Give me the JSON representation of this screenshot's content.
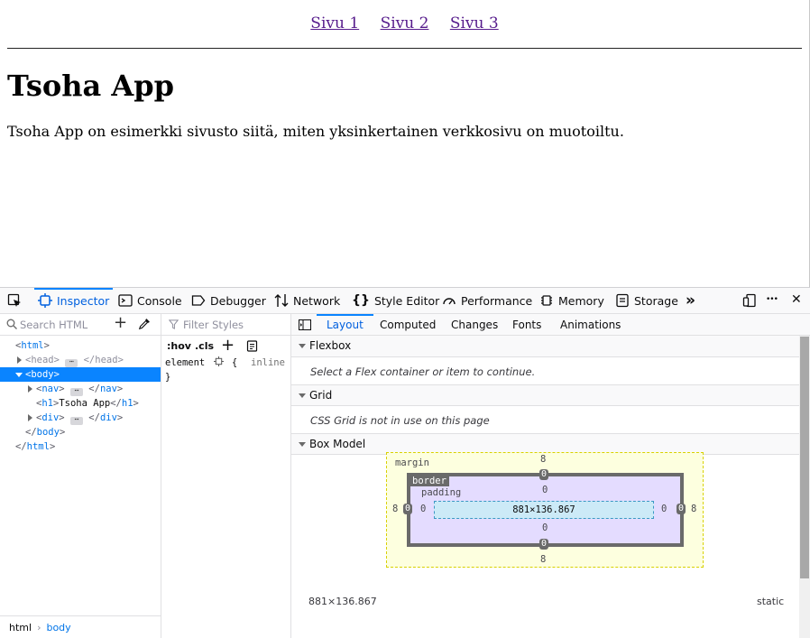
{
  "page": {
    "nav_links": [
      "Sivu 1",
      "Sivu 2",
      "Sivu 3"
    ],
    "heading": "Tsoha App",
    "paragraph": "Tsoha App on esimerkki sivusto siitä, miten yksinkertainen verkkosivu on muotoiltu."
  },
  "toolbox": {
    "tabs": {
      "inspector": "Inspector",
      "console": "Console",
      "debugger": "Debugger",
      "network": "Network",
      "style_editor": "Style Editor",
      "performance": "Performance",
      "memory": "Memory",
      "storage": "Storage"
    },
    "more_symbol": "»",
    "menu_symbol": "•••",
    "close_symbol": "✕"
  },
  "markup": {
    "search_placeholder": "Search HTML",
    "add_symbol": "+",
    "tree": {
      "html_open": "html",
      "head": "head",
      "body": "body",
      "nav": "nav",
      "h1_tag": "h1",
      "h1_text": "Tsoha App",
      "div": "div",
      "ellipsis": "⋯"
    },
    "breadcrumbs": [
      "html",
      "body"
    ]
  },
  "rules": {
    "filter_placeholder": "Filter Styles",
    "hov": ":hov",
    "cls": ".cls",
    "add_symbol": "+",
    "element_selector": "element",
    "open_brace": "{",
    "close_brace": "}",
    "inline_label": "inline"
  },
  "layout": {
    "tabs": [
      "Layout",
      "Computed",
      "Changes",
      "Fonts",
      "Animations"
    ],
    "selected_tab": "Layout",
    "flexbox": {
      "title": "Flexbox",
      "message": "Select a Flex container or item to continue."
    },
    "grid": {
      "title": "Grid",
      "message": "CSS Grid is not in use on this page"
    },
    "box_model": {
      "title": "Box Model",
      "margin_label": "margin",
      "border_label": "border",
      "padding_label": "padding",
      "margin": {
        "top": "8",
        "right": "8",
        "bottom": "8",
        "left": "8"
      },
      "border": {
        "top": "0",
        "right": "0",
        "bottom": "0",
        "left": "0"
      },
      "padding": {
        "top": "0",
        "right": "0",
        "bottom": "0",
        "left": "0"
      },
      "content_size": "881×136.867",
      "footer_size": "881×136.867",
      "position": "static"
    }
  },
  "colors": {
    "accent": "#0a84ff",
    "link_visited": "#551a8b",
    "margin_bg": "#fdffdf",
    "border_bg": "#e4dcff",
    "content_bg": "#cceaf7"
  }
}
